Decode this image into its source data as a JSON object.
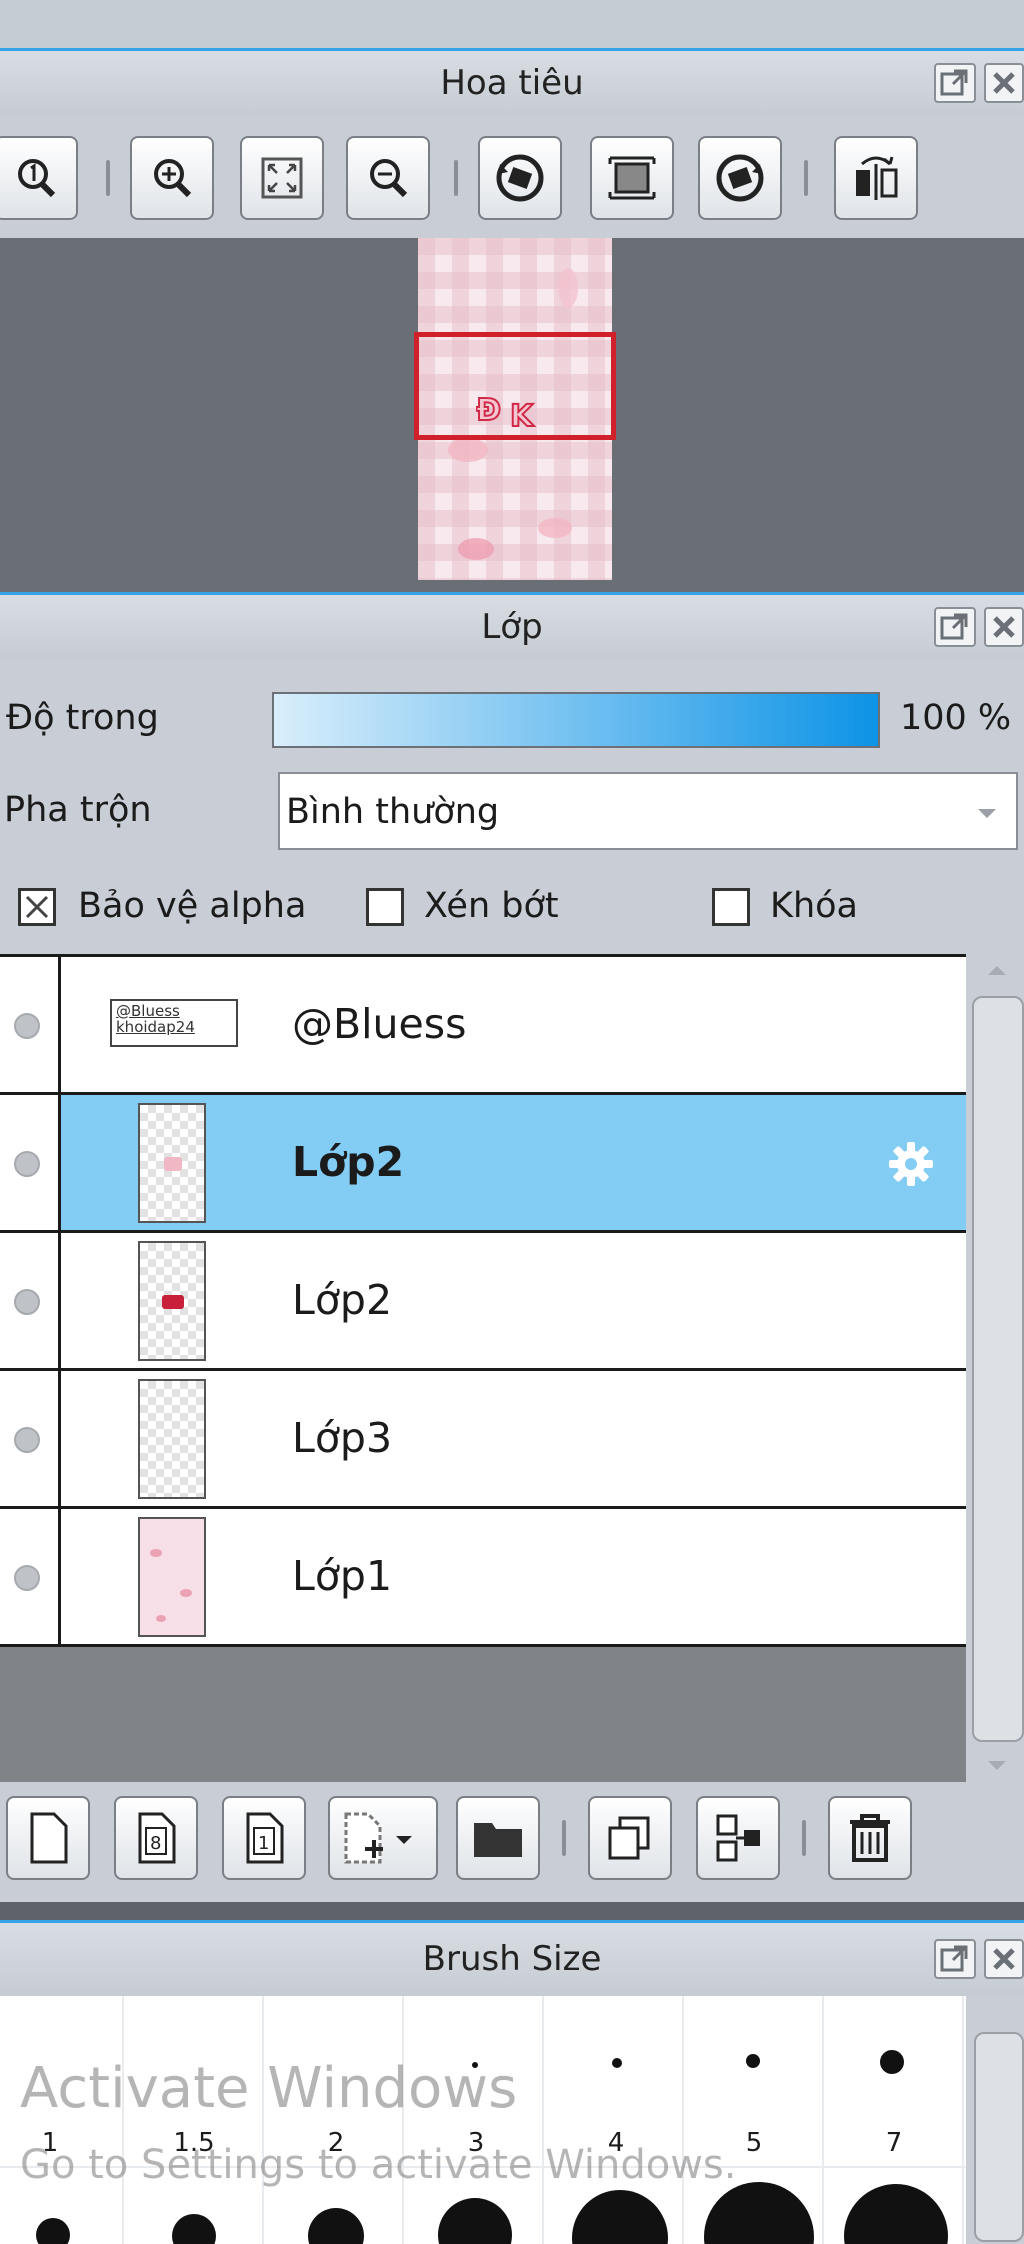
{
  "navigator": {
    "title": "Hoa tiêu",
    "tools": [
      "zoom-actual-icon",
      "zoom-in-icon",
      "fit-window-icon",
      "zoom-out-icon",
      "rotate-left-icon",
      "fit-frame-icon",
      "rotate-right-icon",
      "flip-icon"
    ]
  },
  "layers": {
    "title": "Lớp",
    "opacity_label": "Độ trong",
    "opacity_value": "100 %",
    "opacity_fraction": 1.0,
    "blend_label": "Pha trộn",
    "blend_value": "Bình thường",
    "protect_alpha_label": "Bảo vệ alpha",
    "protect_alpha_checked": true,
    "clip_label": "Xén bớt",
    "clip_checked": false,
    "lock_label": "Khóa",
    "lock_checked": false,
    "items": [
      {
        "name": "@Bluess",
        "thumb_text": "@Bluess khoidap24",
        "selected": false
      },
      {
        "name": "Lớp2",
        "selected": true
      },
      {
        "name": "Lớp2",
        "selected": false
      },
      {
        "name": "Lớp3",
        "selected": false
      },
      {
        "name": "Lớp1",
        "selected": false
      }
    ],
    "toolbar": [
      "new-layer-icon",
      "new-8bit-layer-icon",
      "new-1bit-layer-icon",
      "add-layer-menu-icon",
      "new-folder-icon",
      "duplicate-layer-icon",
      "merge-down-icon",
      "delete-layer-icon"
    ]
  },
  "brush": {
    "title": "Brush Size",
    "sizes": [
      "1",
      "1.5",
      "2",
      "3",
      "4",
      "5",
      "7"
    ]
  },
  "watermark": {
    "line1": "Activate Windows",
    "line2": "Go to Settings to activate Windows."
  },
  "colors": {
    "accent": "#35a5e8",
    "selection": "#83cdf5",
    "frame": "#d0212b"
  }
}
